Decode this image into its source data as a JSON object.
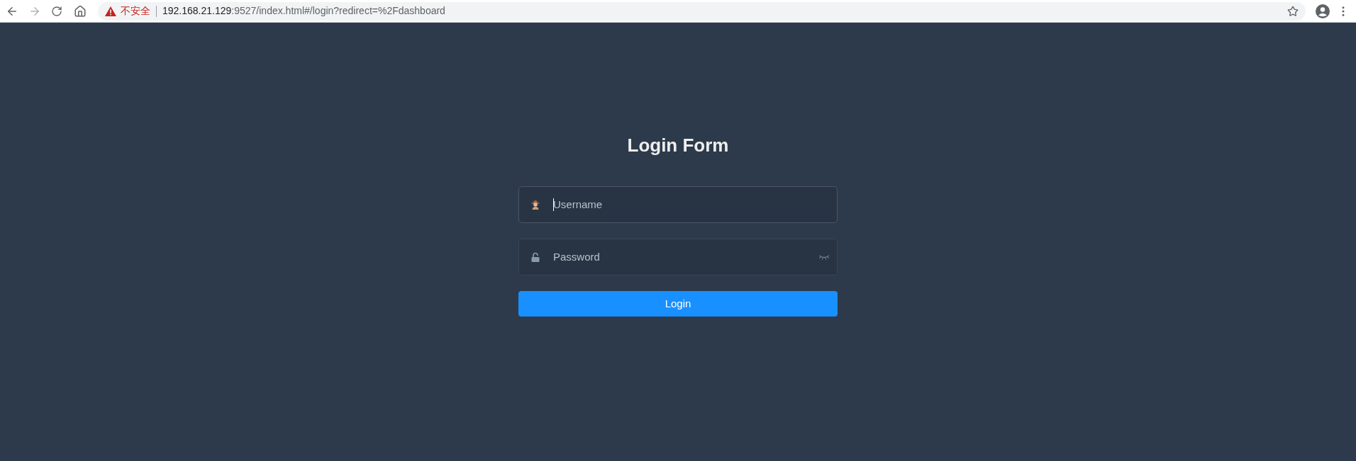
{
  "browser": {
    "security_label": "不安全",
    "url_host": "192.168.21.129",
    "url_rest": ":9527/index.html#/login?redirect=%2Fdashboard"
  },
  "login_form": {
    "title": "Login Form",
    "fields": [
      {
        "kind": "user",
        "placeholder": "Username",
        "focused": true
      },
      {
        "kind": "password",
        "placeholder": "Password",
        "focused": false
      }
    ],
    "button": "Login"
  }
}
